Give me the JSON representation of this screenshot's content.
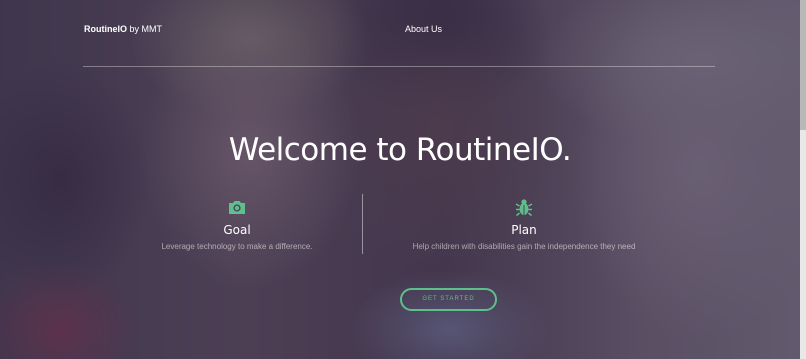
{
  "header": {
    "brand_name": "RoutineIO",
    "brand_suffix": " by MMT",
    "nav_about": "About Us"
  },
  "hero": {
    "title": "Welcome to RoutineIO."
  },
  "features": [
    {
      "icon": "camera-icon",
      "title": "Goal",
      "description": "Leverage technology to make a difference."
    },
    {
      "icon": "bug-icon",
      "title": "Plan",
      "description": "Help children with disabilities gain the independence they need"
    }
  ],
  "cta": {
    "label": "GET STARTED"
  },
  "colors": {
    "accent": "#5fbf8a",
    "overlay": "#342f54"
  }
}
